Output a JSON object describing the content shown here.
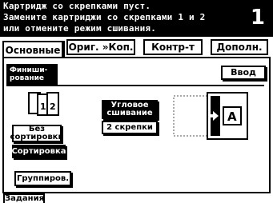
{
  "message": {
    "lines": [
      "Картридж со скрепками пуст.",
      "Замените картриджи со скрепками 1 и 2",
      "или отмените режим сшивания."
    ],
    "counter": "1"
  },
  "tabs": [
    {
      "label": "Основные",
      "active": true
    },
    {
      "label": "Ориг. »Коп.",
      "active": false
    },
    {
      "label": "Контр-т",
      "active": false
    },
    {
      "label": "Дополн.",
      "active": false
    }
  ],
  "finishing": {
    "header_line1": "Финиши-",
    "header_line2": "рование",
    "enter_label": "Ввод"
  },
  "sort_options": {
    "no_sort_line1": "Без",
    "no_sort_line2": "сортировки",
    "sort_label": "Сортировка",
    "group_label": "Группиров."
  },
  "staple_options": {
    "corner_line1": "Угловое",
    "corner_line2": "сшивание",
    "two_staples_label": "2 скрепки"
  },
  "bottom_tab": {
    "label": "Задания"
  }
}
